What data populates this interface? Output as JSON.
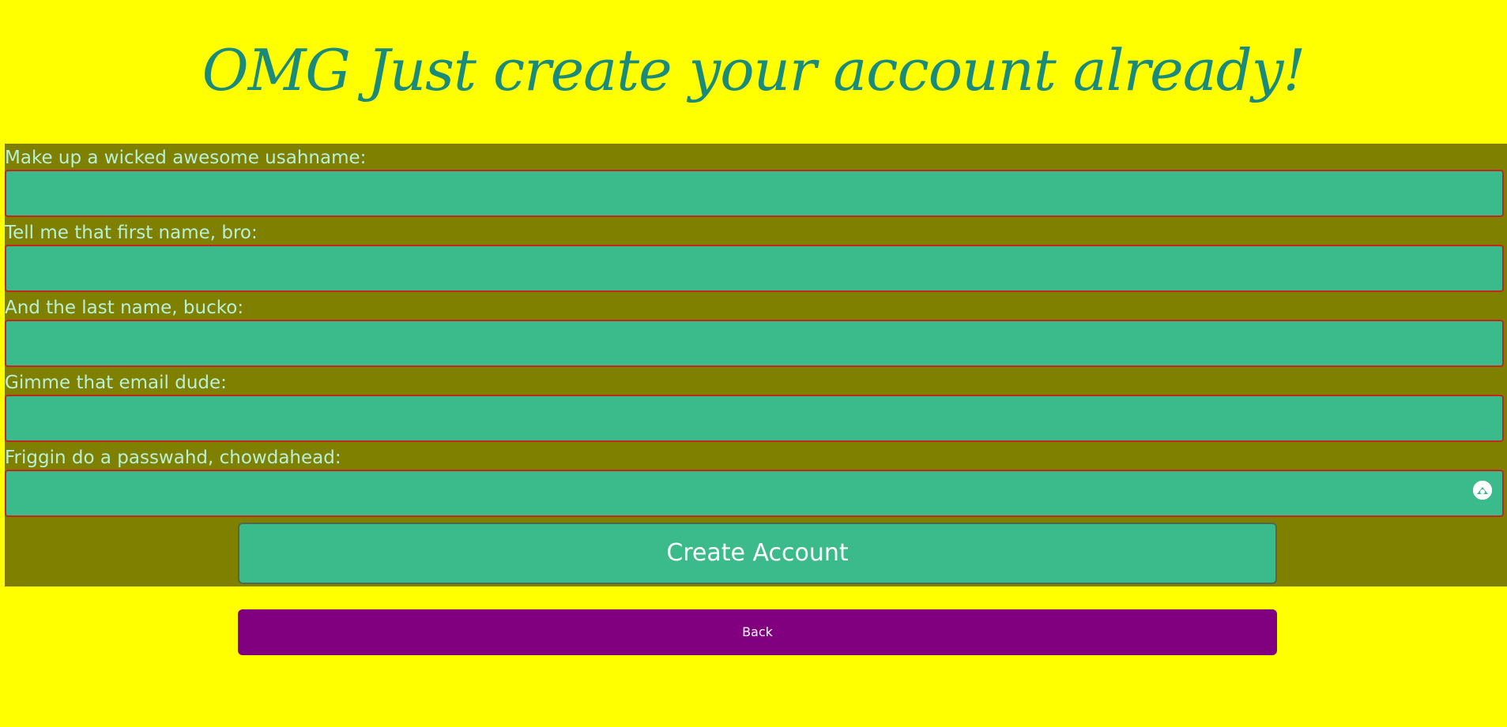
{
  "header": {
    "title": "OMG Just create your account already!"
  },
  "form": {
    "fields": [
      {
        "label": "Make up a wicked awesome usahname:",
        "value": "",
        "type": "text"
      },
      {
        "label": "Tell me that first name, bro:",
        "value": "",
        "type": "text"
      },
      {
        "label": "And the last name, bucko:",
        "value": "",
        "type": "text"
      },
      {
        "label": "Gimme that email dude:",
        "value": "",
        "type": "email"
      },
      {
        "label": "Friggin do a passwahd, chowdahead:",
        "value": "",
        "type": "password"
      }
    ],
    "password_toggle_icon": "password-manager-icon",
    "submit_label": "Create Account"
  },
  "back_label": "Back",
  "colors": {
    "page_background": "#ffff00",
    "title": "#1a8a7a",
    "panel_background": "#808000",
    "label_text": "#b8f0d8",
    "input_background": "#3bba8b",
    "input_border": "#c0281e",
    "back_button": "#800080"
  }
}
